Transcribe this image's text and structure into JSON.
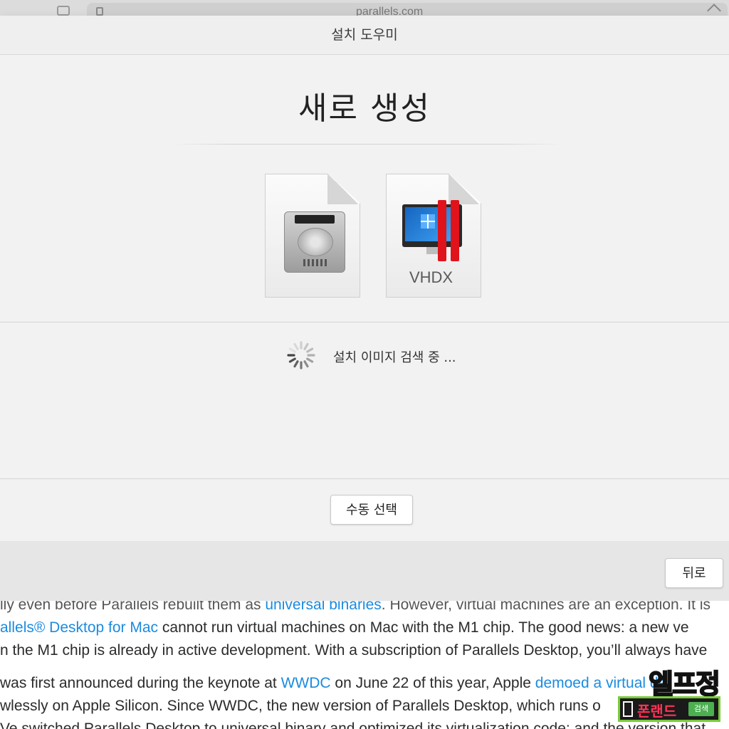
{
  "browser": {
    "url": "parallels.com"
  },
  "dialog": {
    "window_title": "설치 도우미",
    "heading": "새로 생성",
    "vhdx_label": "VHDX",
    "status": "설치 이미지 검색 중 ...",
    "manual_button": "수동 선택",
    "back_button": "뒤로"
  },
  "article": {
    "line1_a": "lly even before Parallels rebuilt them as ",
    "line1_link": "universal binaries",
    "line1_b": ". However, virtual machines are an exception. It is",
    "line2_link": "allels® Desktop for Mac",
    "line2_b": " cannot run virtual machines on Mac with the M1 chip. The good news: a new ve",
    "line3": "n the M1 chip is already in active development. With a subscription of Parallels Desktop, you’ll always have",
    "line4_a": " was first announced during the keynote at ",
    "line4_link1": "WWDC",
    "line4_b": " on June 22 of this year, Apple ",
    "line4_link2": "demoed a virtual de",
    "line5": "wlessly on Apple Silicon. Since WWDC, the new version of Parallels Desktop, which runs o",
    "line6": "Ve switched Parallels Desktop to universal binary and optimized its virtualization code; and the version that"
  },
  "watermark": {
    "top_text": "엘프정",
    "name": "폰랜드",
    "search_label": "검색"
  },
  "colors": {
    "link": "#1a8be0",
    "parallels_red": "#e0131b"
  }
}
